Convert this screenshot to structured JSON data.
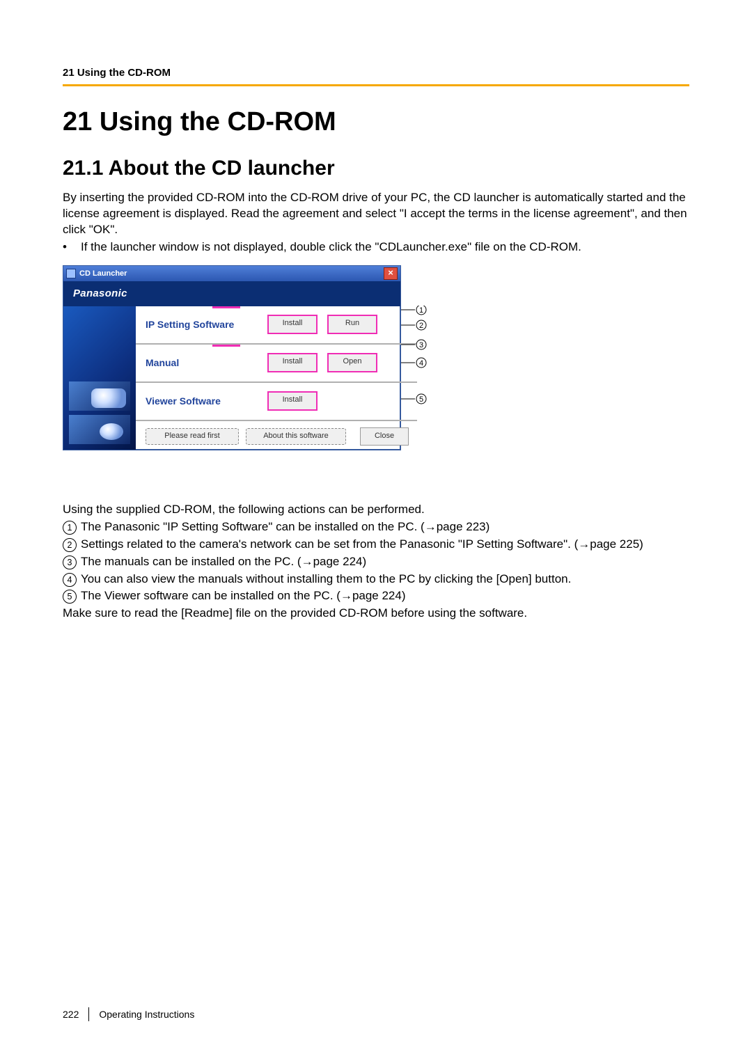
{
  "header": {
    "breadcrumb": "21 Using the CD-ROM"
  },
  "chapter": {
    "number_title": "21   Using the CD-ROM"
  },
  "section": {
    "number_title": "21.1  About the CD launcher"
  },
  "intro_para": "By inserting the provided CD-ROM into the CD-ROM drive of your PC, the CD launcher is automatically started and the license agreement is displayed. Read the agreement and select \"I accept the terms in the license agreement\", and then click \"OK\".",
  "intro_bullet": "If the launcher window is not displayed, double click the \"CDLauncher.exe\" file on the CD-ROM.",
  "launcher": {
    "title": "CD Launcher",
    "brand": "Panasonic",
    "rows": {
      "ip": {
        "label": "IP Setting Software",
        "btn1": "Install",
        "btn2": "Run"
      },
      "manual": {
        "label": "Manual",
        "btn1": "Install",
        "btn2": "Open"
      },
      "viewer": {
        "label": "Viewer Software",
        "btn1": "Install"
      }
    },
    "bottom": {
      "readme": "Please read first",
      "about": "About this software",
      "close": "Close"
    }
  },
  "after_fig_intro": "Using the supplied CD-ROM, the following actions can be performed.",
  "callouts": {
    "1": "The Panasonic \"IP Setting Software\" can be installed on the PC. (→page 223)",
    "2": "Settings related to the camera's network can be set from the Panasonic \"IP Setting Software\". (→page 225)",
    "3": "The manuals can be installed on the PC. (→page 224)",
    "4": "You can also view the manuals without installing them to the PC by clicking the [Open] button.",
    "5": "The Viewer software can be installed on the PC. (→page 224)"
  },
  "closing": "Make sure to read the [Readme] file on the provided CD-ROM before using the software.",
  "footer": {
    "page": "222",
    "doc": "Operating Instructions"
  }
}
